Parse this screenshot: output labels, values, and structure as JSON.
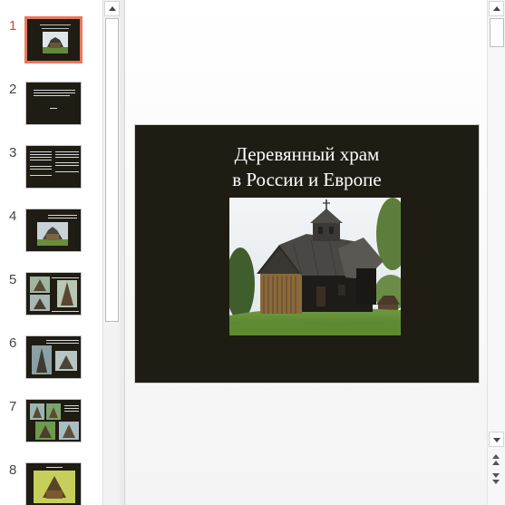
{
  "slides": [
    {
      "number": "1",
      "active": true
    },
    {
      "number": "2",
      "active": false
    },
    {
      "number": "3",
      "active": false
    },
    {
      "number": "4",
      "active": false
    },
    {
      "number": "5",
      "active": false
    },
    {
      "number": "6",
      "active": false
    },
    {
      "number": "7",
      "active": false
    },
    {
      "number": "8",
      "active": false
    }
  ],
  "current_slide": {
    "title_line1": "Деревянный храм",
    "title_line2": "в России и Европе",
    "background_color": "#1f1c14",
    "photo": "wooden-stave-church-photo"
  },
  "accent_color": "#d24726",
  "icons": {
    "scroll_up": "chevron-up-icon",
    "scroll_down": "chevron-down-icon",
    "prev_slide": "double-chevron-up-icon",
    "next_slide": "double-chevron-down-icon"
  }
}
